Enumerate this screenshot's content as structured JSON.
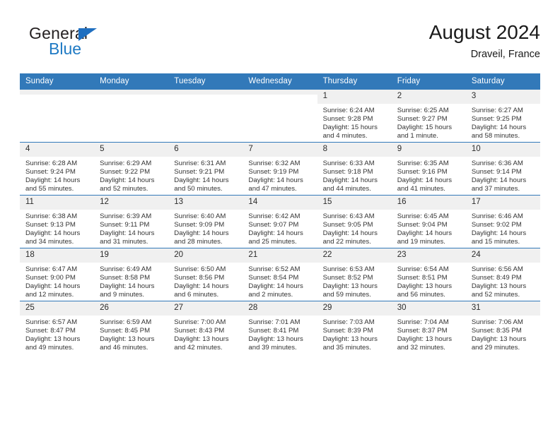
{
  "brand": {
    "name_part1": "General",
    "name_part2": "Blue",
    "triangle_color": "#1f6fc0",
    "blue_color": "#1f7ac4"
  },
  "header": {
    "title": "August 2024",
    "subtitle": "Draveil, France"
  },
  "colors": {
    "header_row": "#3279b9",
    "daynum_band": "#f0f0f0",
    "grid_line": "#3279b9"
  },
  "weekdays": [
    "Sunday",
    "Monday",
    "Tuesday",
    "Wednesday",
    "Thursday",
    "Friday",
    "Saturday"
  ],
  "weeks": [
    [
      {
        "day": "",
        "empty": true
      },
      {
        "day": "",
        "empty": true
      },
      {
        "day": "",
        "empty": true
      },
      {
        "day": "",
        "empty": true
      },
      {
        "day": "1",
        "sunrise": "Sunrise: 6:24 AM",
        "sunset": "Sunset: 9:28 PM",
        "daylight1": "Daylight: 15 hours",
        "daylight2": "and 4 minutes."
      },
      {
        "day": "2",
        "sunrise": "Sunrise: 6:25 AM",
        "sunset": "Sunset: 9:27 PM",
        "daylight1": "Daylight: 15 hours",
        "daylight2": "and 1 minute."
      },
      {
        "day": "3",
        "sunrise": "Sunrise: 6:27 AM",
        "sunset": "Sunset: 9:25 PM",
        "daylight1": "Daylight: 14 hours",
        "daylight2": "and 58 minutes."
      }
    ],
    [
      {
        "day": "4",
        "sunrise": "Sunrise: 6:28 AM",
        "sunset": "Sunset: 9:24 PM",
        "daylight1": "Daylight: 14 hours",
        "daylight2": "and 55 minutes."
      },
      {
        "day": "5",
        "sunrise": "Sunrise: 6:29 AM",
        "sunset": "Sunset: 9:22 PM",
        "daylight1": "Daylight: 14 hours",
        "daylight2": "and 52 minutes."
      },
      {
        "day": "6",
        "sunrise": "Sunrise: 6:31 AM",
        "sunset": "Sunset: 9:21 PM",
        "daylight1": "Daylight: 14 hours",
        "daylight2": "and 50 minutes."
      },
      {
        "day": "7",
        "sunrise": "Sunrise: 6:32 AM",
        "sunset": "Sunset: 9:19 PM",
        "daylight1": "Daylight: 14 hours",
        "daylight2": "and 47 minutes."
      },
      {
        "day": "8",
        "sunrise": "Sunrise: 6:33 AM",
        "sunset": "Sunset: 9:18 PM",
        "daylight1": "Daylight: 14 hours",
        "daylight2": "and 44 minutes."
      },
      {
        "day": "9",
        "sunrise": "Sunrise: 6:35 AM",
        "sunset": "Sunset: 9:16 PM",
        "daylight1": "Daylight: 14 hours",
        "daylight2": "and 41 minutes."
      },
      {
        "day": "10",
        "sunrise": "Sunrise: 6:36 AM",
        "sunset": "Sunset: 9:14 PM",
        "daylight1": "Daylight: 14 hours",
        "daylight2": "and 37 minutes."
      }
    ],
    [
      {
        "day": "11",
        "sunrise": "Sunrise: 6:38 AM",
        "sunset": "Sunset: 9:13 PM",
        "daylight1": "Daylight: 14 hours",
        "daylight2": "and 34 minutes."
      },
      {
        "day": "12",
        "sunrise": "Sunrise: 6:39 AM",
        "sunset": "Sunset: 9:11 PM",
        "daylight1": "Daylight: 14 hours",
        "daylight2": "and 31 minutes."
      },
      {
        "day": "13",
        "sunrise": "Sunrise: 6:40 AM",
        "sunset": "Sunset: 9:09 PM",
        "daylight1": "Daylight: 14 hours",
        "daylight2": "and 28 minutes."
      },
      {
        "day": "14",
        "sunrise": "Sunrise: 6:42 AM",
        "sunset": "Sunset: 9:07 PM",
        "daylight1": "Daylight: 14 hours",
        "daylight2": "and 25 minutes."
      },
      {
        "day": "15",
        "sunrise": "Sunrise: 6:43 AM",
        "sunset": "Sunset: 9:05 PM",
        "daylight1": "Daylight: 14 hours",
        "daylight2": "and 22 minutes."
      },
      {
        "day": "16",
        "sunrise": "Sunrise: 6:45 AM",
        "sunset": "Sunset: 9:04 PM",
        "daylight1": "Daylight: 14 hours",
        "daylight2": "and 19 minutes."
      },
      {
        "day": "17",
        "sunrise": "Sunrise: 6:46 AM",
        "sunset": "Sunset: 9:02 PM",
        "daylight1": "Daylight: 14 hours",
        "daylight2": "and 15 minutes."
      }
    ],
    [
      {
        "day": "18",
        "sunrise": "Sunrise: 6:47 AM",
        "sunset": "Sunset: 9:00 PM",
        "daylight1": "Daylight: 14 hours",
        "daylight2": "and 12 minutes."
      },
      {
        "day": "19",
        "sunrise": "Sunrise: 6:49 AM",
        "sunset": "Sunset: 8:58 PM",
        "daylight1": "Daylight: 14 hours",
        "daylight2": "and 9 minutes."
      },
      {
        "day": "20",
        "sunrise": "Sunrise: 6:50 AM",
        "sunset": "Sunset: 8:56 PM",
        "daylight1": "Daylight: 14 hours",
        "daylight2": "and 6 minutes."
      },
      {
        "day": "21",
        "sunrise": "Sunrise: 6:52 AM",
        "sunset": "Sunset: 8:54 PM",
        "daylight1": "Daylight: 14 hours",
        "daylight2": "and 2 minutes."
      },
      {
        "day": "22",
        "sunrise": "Sunrise: 6:53 AM",
        "sunset": "Sunset: 8:52 PM",
        "daylight1": "Daylight: 13 hours",
        "daylight2": "and 59 minutes."
      },
      {
        "day": "23",
        "sunrise": "Sunrise: 6:54 AM",
        "sunset": "Sunset: 8:51 PM",
        "daylight1": "Daylight: 13 hours",
        "daylight2": "and 56 minutes."
      },
      {
        "day": "24",
        "sunrise": "Sunrise: 6:56 AM",
        "sunset": "Sunset: 8:49 PM",
        "daylight1": "Daylight: 13 hours",
        "daylight2": "and 52 minutes."
      }
    ],
    [
      {
        "day": "25",
        "sunrise": "Sunrise: 6:57 AM",
        "sunset": "Sunset: 8:47 PM",
        "daylight1": "Daylight: 13 hours",
        "daylight2": "and 49 minutes."
      },
      {
        "day": "26",
        "sunrise": "Sunrise: 6:59 AM",
        "sunset": "Sunset: 8:45 PM",
        "daylight1": "Daylight: 13 hours",
        "daylight2": "and 46 minutes."
      },
      {
        "day": "27",
        "sunrise": "Sunrise: 7:00 AM",
        "sunset": "Sunset: 8:43 PM",
        "daylight1": "Daylight: 13 hours",
        "daylight2": "and 42 minutes."
      },
      {
        "day": "28",
        "sunrise": "Sunrise: 7:01 AM",
        "sunset": "Sunset: 8:41 PM",
        "daylight1": "Daylight: 13 hours",
        "daylight2": "and 39 minutes."
      },
      {
        "day": "29",
        "sunrise": "Sunrise: 7:03 AM",
        "sunset": "Sunset: 8:39 PM",
        "daylight1": "Daylight: 13 hours",
        "daylight2": "and 35 minutes."
      },
      {
        "day": "30",
        "sunrise": "Sunrise: 7:04 AM",
        "sunset": "Sunset: 8:37 PM",
        "daylight1": "Daylight: 13 hours",
        "daylight2": "and 32 minutes."
      },
      {
        "day": "31",
        "sunrise": "Sunrise: 7:06 AM",
        "sunset": "Sunset: 8:35 PM",
        "daylight1": "Daylight: 13 hours",
        "daylight2": "and 29 minutes."
      }
    ]
  ]
}
